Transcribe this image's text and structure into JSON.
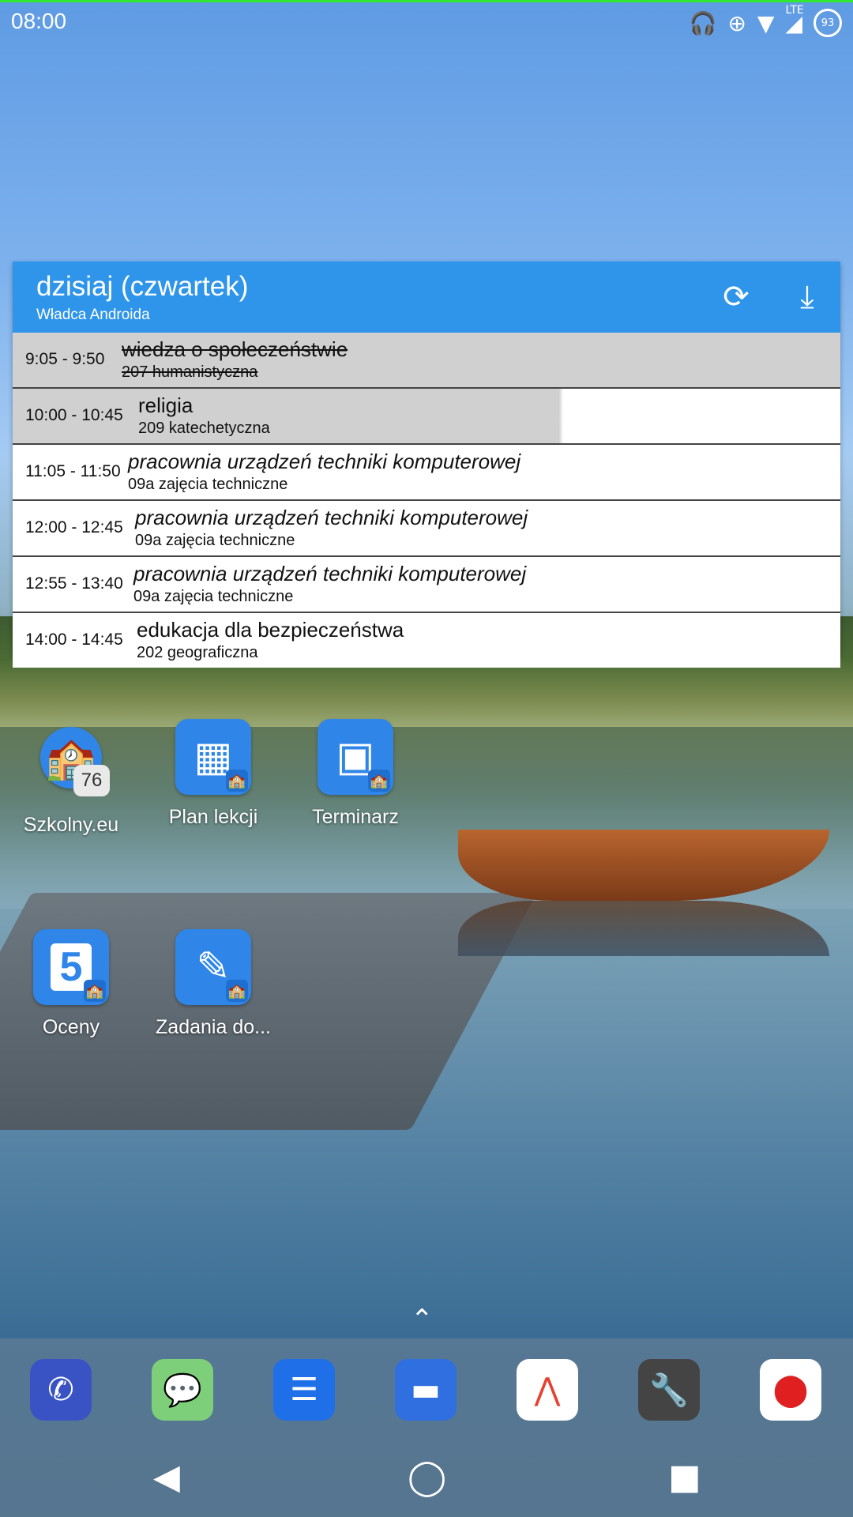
{
  "status_bar": {
    "time": "08:00",
    "battery_level": "93",
    "network": "LTE",
    "icons": [
      "headphones-icon",
      "data-saver-icon",
      "wifi-icon",
      "signal-icon",
      "battery-icon"
    ]
  },
  "widget": {
    "title": "dzisiaj (czwartek)",
    "subtitle": "Władca Androida",
    "lessons": [
      {
        "time": "9:05 - 9:50",
        "name": "wiedza o społeczeństwie",
        "room": "207 humanistyczna"
      },
      {
        "time": "10:00 - 10:45",
        "name": "religia",
        "room": "209 katechetyczna"
      },
      {
        "time": "11:05 - 11:50",
        "name": "pracownia urządzeń techniki komputerowej",
        "room": "09a zajęcia techniczne"
      },
      {
        "time": "12:00 - 12:45",
        "name": "pracownia urządzeń techniki komputerowej",
        "room": "09a zajęcia techniczne"
      },
      {
        "time": "12:55 - 13:40",
        "name": "pracownia urządzeń techniki komputerowej",
        "room": "09a zajęcia techniczne"
      },
      {
        "time": "14:00 - 14:45",
        "name": "edukacja dla bezpieczeństwa",
        "room": "202 geograficzna"
      }
    ]
  },
  "apps": [
    {
      "label": "Szkolny.eu",
      "badge": "76"
    },
    {
      "label": "Plan lekcji"
    },
    {
      "label": "Terminarz"
    },
    {
      "label": "Oceny",
      "glyph": "5"
    },
    {
      "label": "Zadania do..."
    }
  ],
  "dock": [
    "phone-icon",
    "messenger-icon",
    "messages-icon",
    "files-icon",
    "app-icon",
    "tools-icon",
    "screen-recorder-icon"
  ],
  "colors": {
    "widget_header": "#2e95ea",
    "app_blue": "#2f86e8"
  }
}
